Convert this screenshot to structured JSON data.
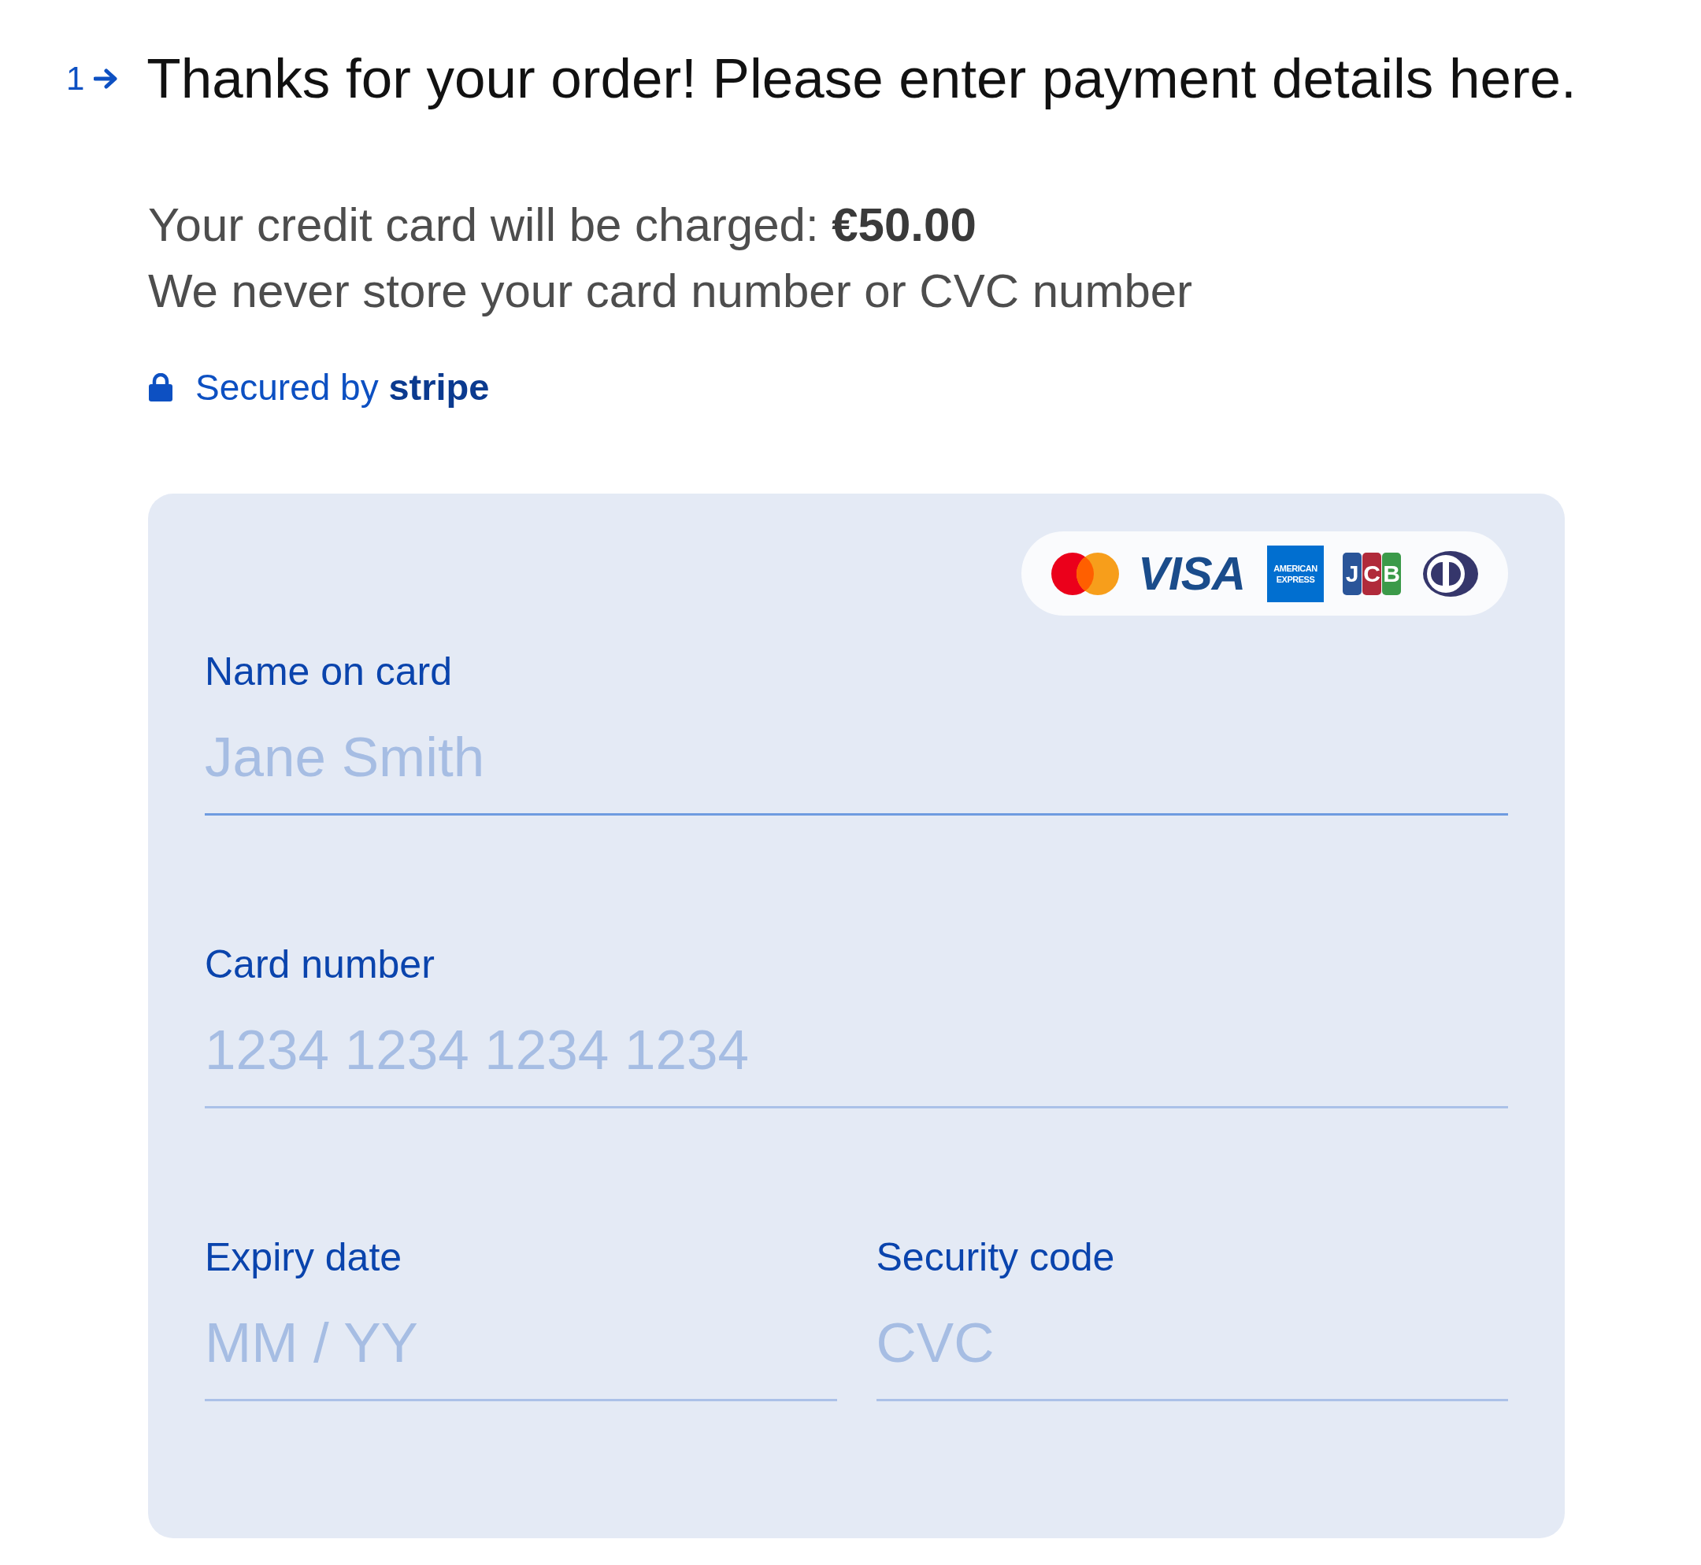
{
  "question": {
    "number": "1",
    "title": "Thanks for your order! Please enter payment details here."
  },
  "charge_notice": "Your credit card will be charged: **€50.00**",
  "storage_notice": "We never store your card number or CVC number",
  "secure_badge": "Secured by **stripe**",
  "card_form": {
    "accepted_cards": [
      {
        "kind": "mastercard"
      },
      {
        "kind": "visa",
        "text": "VISA"
      },
      {
        "kind": "amex",
        "lines": [
          "AMERICAN",
          "EXPRESS"
        ]
      },
      {
        "kind": "jcb",
        "text": "JCB"
      },
      {
        "kind": "diners"
      }
    ],
    "field_rows": [
      {
        "fields": [
          {
            "label": "Name on card",
            "placeholder": "Jane Smith",
            "focused": true
          }
        ]
      },
      {
        "fields": [
          {
            "label": "Card number",
            "placeholder": "1234 1234 1234 1234",
            "focused": false
          }
        ]
      },
      {
        "fields": [
          {
            "label": "Expiry date",
            "placeholder": "MM / YY",
            "focused": false
          },
          {
            "label": "Security code",
            "placeholder": "CVC",
            "focused": false
          }
        ]
      }
    ]
  }
}
